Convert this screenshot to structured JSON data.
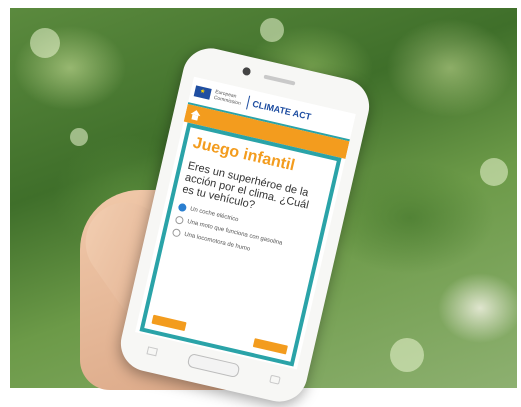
{
  "scene": {
    "description_colors": {
      "accent": "#f39c1e",
      "teal": "#2aa3a8",
      "eu_blue": "#1f4ea1"
    }
  },
  "app": {
    "header": {
      "org_label": "European Commission",
      "brand": "CLIMATE ACT"
    },
    "card": {
      "title": "Juego infantil",
      "question": "Eres un superhéroe de la acción por el clima. ¿Cuál es tu vehículo?",
      "options": [
        {
          "label": "Un coche eléctrico",
          "selected": true
        },
        {
          "label": "Una moto que funciona con gasolina",
          "selected": false
        },
        {
          "label": "Una locomotora de humo",
          "selected": false
        }
      ]
    }
  }
}
